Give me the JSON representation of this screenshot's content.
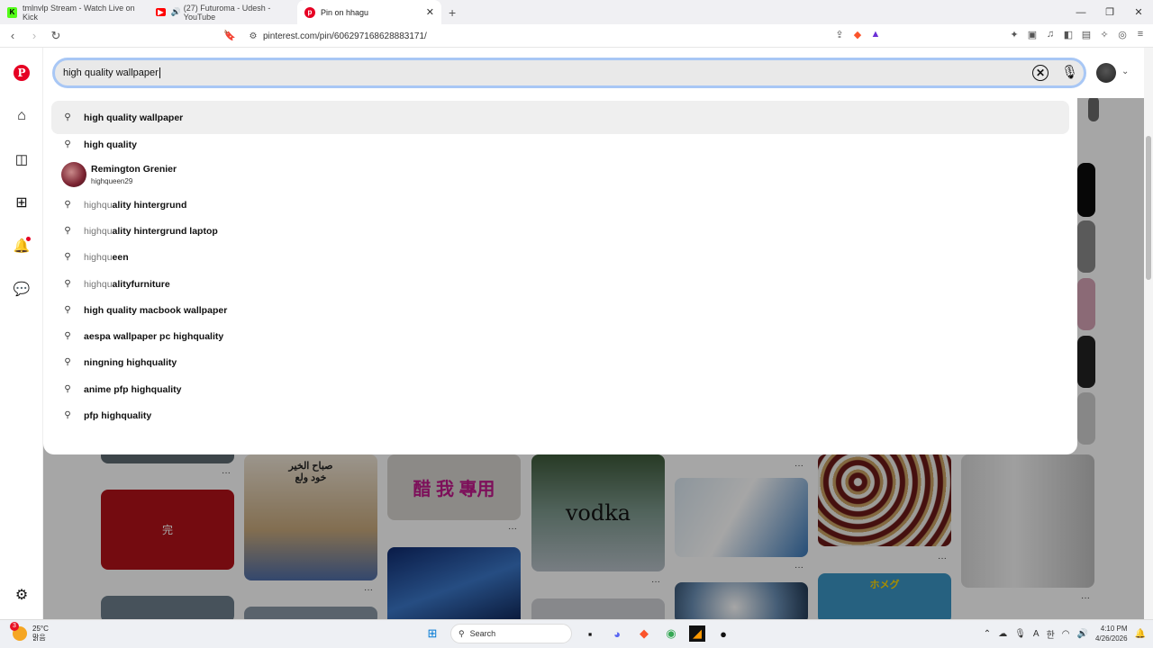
{
  "browser": {
    "tabs": [
      {
        "title": "tmlnvlp Stream - Watch Live on Kick",
        "icon": "kick-icon"
      },
      {
        "title": "(27) Futuroma - Udesh - YouTube",
        "icon": "youtube-icon"
      },
      {
        "title": "Pin on hhagu",
        "icon": "pinterest-icon"
      }
    ],
    "url": "pinterest.com/pin/606297168628883171/"
  },
  "search": {
    "query": "high quality wallpaper"
  },
  "suggestions": [
    {
      "prefix": "",
      "text": "high quality wallpaper"
    },
    {
      "prefix": "",
      "text": "high quality"
    },
    {
      "prefix": "highqu",
      "text": "ality hintergrund"
    },
    {
      "prefix": "highqu",
      "text": "ality hintergrund laptop"
    },
    {
      "prefix": "highqu",
      "text": "een"
    },
    {
      "prefix": "highqu",
      "text": "alityfurniture"
    },
    {
      "prefix": "",
      "text": "high quality macbook wallpaper"
    },
    {
      "prefix": "",
      "text": "aespa wallpaper pc highquality"
    },
    {
      "prefix": "",
      "text": "ningning highquality"
    },
    {
      "prefix": "",
      "text": "anime pfp highquality"
    },
    {
      "prefix": "",
      "text": "pfp highquality"
    }
  ],
  "profile_suggestion": {
    "name": "Remington Grenier",
    "handle": "highqueen29"
  },
  "pins": {
    "p1": "完",
    "p2": "صباح الخير خود ولع",
    "p3": "醋 我 專用",
    "p4": "vodka",
    "p5": "ホメグ"
  },
  "taskbar": {
    "temp": "25°C",
    "weather": "맑음",
    "badge": "3",
    "search": "Search",
    "time": "4:10 PM",
    "date": "4/26/2026"
  },
  "colors": {
    "brand": "#e60023",
    "focus_ring": "#a8c7f5"
  }
}
